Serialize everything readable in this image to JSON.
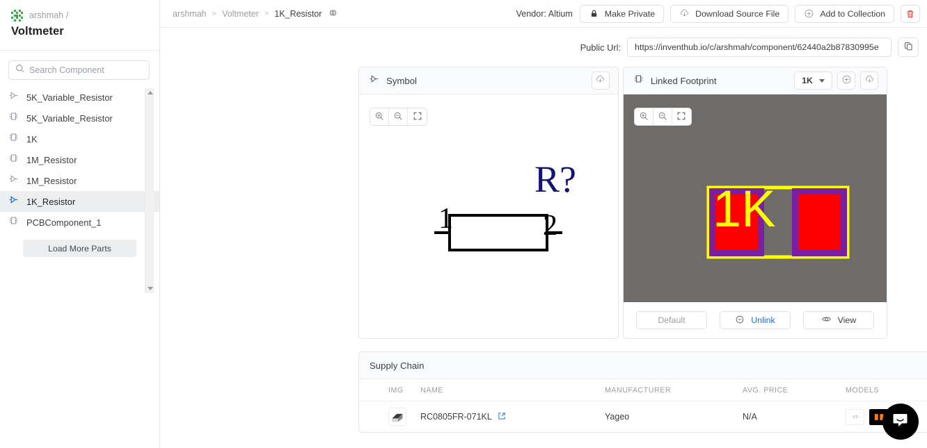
{
  "sidebar": {
    "owner": "arshmah /",
    "project": "Voltmeter",
    "search_placeholder": "Search Component",
    "items": [
      {
        "label": "5K_Variable_Resistor",
        "icon": "symbol-icon",
        "active": false
      },
      {
        "label": "5K_Variable_Resistor",
        "icon": "footprint-icon",
        "active": false
      },
      {
        "label": "1K",
        "icon": "footprint-icon",
        "active": false
      },
      {
        "label": "1M_Resistor",
        "icon": "footprint-icon",
        "active": false
      },
      {
        "label": "1M_Resistor",
        "icon": "symbol-icon",
        "active": false
      },
      {
        "label": "1K_Resistor",
        "icon": "symbol-icon",
        "active": true
      },
      {
        "label": "PCBComponent_1",
        "icon": "footprint-icon",
        "active": false
      }
    ],
    "load_more_label": "Load More Parts"
  },
  "topbar": {
    "breadcrumb": [
      "arshmah",
      "Voltmeter",
      "1K_Resistor"
    ],
    "separator": ">",
    "globe_icon": "globe-icon",
    "vendor_label": "Vendor: Altium",
    "make_private_label": "Make Private",
    "download_source_label": "Download Source File",
    "add_collection_label": "Add to Collection",
    "delete_icon": "trash-icon",
    "delete_color": "#e53935"
  },
  "url_row": {
    "label": "Public Url:",
    "value": "https://inventhub.io/c/arshmah/component/62440a2b87830995e",
    "copy_icon": "copy-icon"
  },
  "symbol_panel": {
    "title": "Symbol",
    "icon": "symbol-icon",
    "download_icon": "cloud-download-icon",
    "zoom_in_icon": "zoom-in-icon",
    "zoom_out_icon": "zoom-out-icon",
    "fullscreen_icon": "fullscreen-icon",
    "designator": "R?",
    "pin1": "1",
    "pin2": "2",
    "designator_color": "#141478"
  },
  "footprint_panel": {
    "title": "Linked Footprint",
    "icon": "footprint-icon",
    "selected_footprint": "1K",
    "add_icon": "plus-circle-icon",
    "download_icon": "cloud-download-icon",
    "zoom_in_icon": "zoom-in-icon",
    "zoom_out_icon": "zoom-out-icon",
    "fullscreen_icon": "fullscreen-icon",
    "canvas_bg": "#6f6b69",
    "outline_color": "#ffff00",
    "pad_fill": "#ff0000",
    "pad_border": "#7b1fa2",
    "silk_text": "1K",
    "default_label": "Default",
    "unlink_label": "Unlink",
    "unlink_icon": "minus-circle-icon",
    "unlink_color": "#1a6fd4",
    "view_label": "View",
    "view_icon": "eye-icon"
  },
  "supply_chain": {
    "title": "Supply Chain",
    "edit_icon": "pencil-icon",
    "columns": [
      "IMG",
      "NAME",
      "MANUFACTURER",
      "AVG. PRICE",
      "MODELS"
    ],
    "rows": [
      {
        "img": "component-thumbnail",
        "name": "RC0805FR-071KL",
        "link_icon": "external-link-icon",
        "manufacturer": "Yageo",
        "avg_price": "N/A",
        "models": [
          "symbol-model",
          "footprint-model",
          "3d-model"
        ]
      }
    ]
  },
  "chat": {
    "icon": "chat-bubble-icon"
  }
}
